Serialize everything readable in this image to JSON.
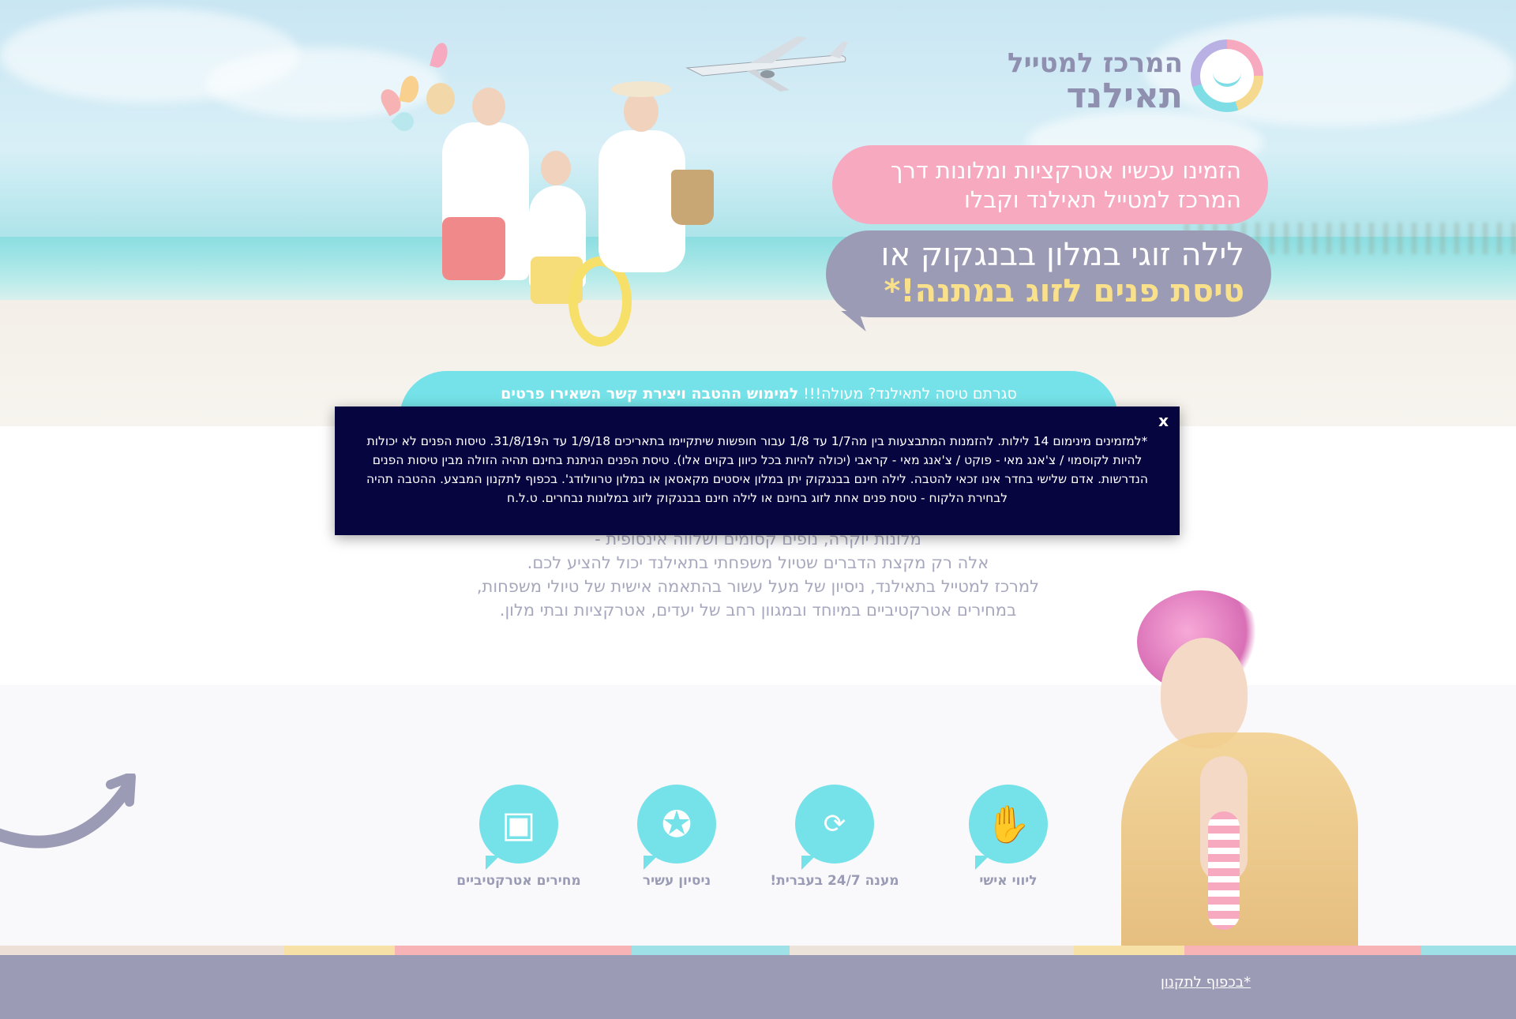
{
  "logo": {
    "line1": "המרכז למטייל",
    "line2": "תאילנד"
  },
  "hero": {
    "pink_bubble_line1": "הזמינו עכשיו אטרקציות ומלונות דרך",
    "pink_bubble_line2": "המרכז למטייל תאילנד וקבלו",
    "purple_bubble_line1": "לילה זוגי במלון בבנגקוק או",
    "purple_bubble_line2": "טיסת פנים לזוג במתנה!*"
  },
  "banner": {
    "text_plain": "סגרתם טיסה לתאילנד? מעולה!!! ",
    "text_bold": "למימוש ההטבה ויצירת קשר השאירו פרטים"
  },
  "body": {
    "line1": "מלונות יוקרה, נופים קסומים ושלווה אינסופית -",
    "line2": "אלה רק מקצת הדברים שטיול משפחתי בתאילנד יכול להציע לכם.",
    "line3": "למרכז למטייל בתאילנד, ניסיון של מעל עשור בהתאמה אישית של טיולי משפחות,",
    "line4": "במחירים אטרקטיביים במיוחד ובמגוון רחב של יעדים, אטרקציות ובתי מלון."
  },
  "features": [
    {
      "icon": "handshake-icon",
      "label": "ליווי אישי"
    },
    {
      "icon": "clock-24-icon",
      "label": "מענה 24/7 בעברית!"
    },
    {
      "icon": "award-ribbon-icon",
      "label": "ניסיון עשיר"
    },
    {
      "icon": "wallet-icon",
      "label": "מחירים אטרקטיביים"
    }
  ],
  "modal": {
    "close_label": "x",
    "text": "*למזמינים מינימום 14 לילות. להזמנות המתבצעות בין מה1/7 עד 1/8 עבור חופשות שיתקיימו בתאריכים 1/9/18 עד ה31/8/19. טיסות הפנים לא יכולות להיות לקוסמוי / צ'אנג מאי - פוקט / צ'אנג מאי - קראבי (יכולה להיות בכל כיוון בקוים אלו). טיסת הפנים הניתנת בחינם תהיה הזולה מבין טיסות הפנים הנדרשות. אדם שלישי בחדר אינו זכאי להטבה. לילה חינם בבנגקוק יתן במלון איסטים מקאסאן או במלון טרוולודג'. בכפוף לתקנון המבצע. ההטבה תהיה לבחירת הלקוח - טיסת פנים אחת לזוג בחינם או לילה חינם בבנגקוק לזוג במלונות נבחרים. ט.ל.ח"
  },
  "footer": {
    "link": "*בכפוף לתקנון"
  },
  "colors": {
    "pink": "#f7a9c0",
    "purple": "#9b9bb5",
    "teal": "#74e2e8",
    "yellow": "#f9e08b",
    "modal_bg": "#06053f"
  }
}
